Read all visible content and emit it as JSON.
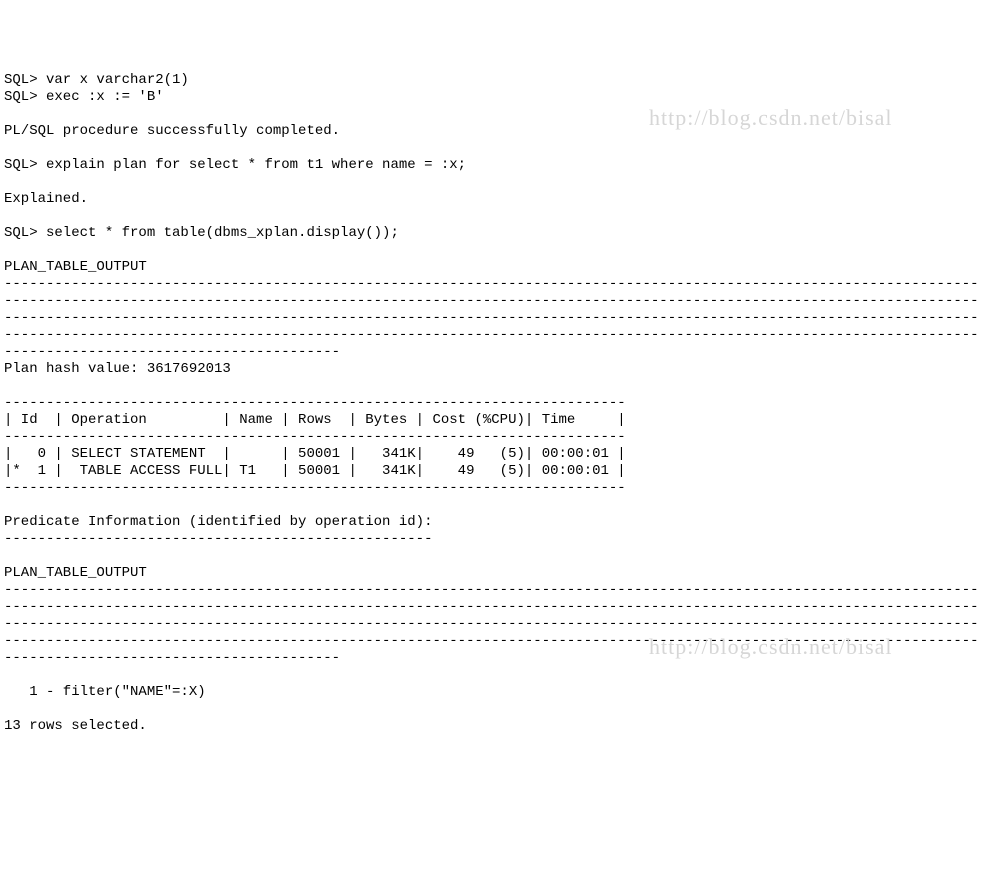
{
  "watermark": "http://blog.csdn.net/bisal",
  "sql": {
    "line01": "SQL> var x varchar2(1)",
    "line02": "SQL> exec :x := 'B'",
    "line03": "",
    "line04": "PL/SQL procedure successfully completed.",
    "line05": "",
    "line06": "SQL> explain plan for select * from t1 where name = :x;",
    "line07": "",
    "line08": "Explained.",
    "line09": "",
    "line10": "SQL> select * from table(dbms_xplan.display());",
    "line11": "",
    "line12": "PLAN_TABLE_OUTPUT",
    "line13": "--------------------------------------------------------------------------------------------------------------------",
    "line14": "--------------------------------------------------------------------------------------------------------------------",
    "line15": "--------------------------------------------------------------------------------------------------------------------",
    "line16": "--------------------------------------------------------------------------------------------------------------------",
    "line17": "----------------------------------------",
    "line18": "Plan hash value: 3617692013",
    "line19": "",
    "line20": "--------------------------------------------------------------------------",
    "line21": "| Id  | Operation         | Name | Rows  | Bytes | Cost (%CPU)| Time     |",
    "line22": "--------------------------------------------------------------------------",
    "line23": "|   0 | SELECT STATEMENT  |      | 50001 |   341K|    49   (5)| 00:00:01 |",
    "line24": "|*  1 |  TABLE ACCESS FULL| T1   | 50001 |   341K|    49   (5)| 00:00:01 |",
    "line25": "--------------------------------------------------------------------------",
    "line26": "",
    "line27": "Predicate Information (identified by operation id):",
    "line28": "---------------------------------------------------",
    "line29": "",
    "line30": "PLAN_TABLE_OUTPUT",
    "line31": "--------------------------------------------------------------------------------------------------------------------",
    "line32": "--------------------------------------------------------------------------------------------------------------------",
    "line33": "--------------------------------------------------------------------------------------------------------------------",
    "line34": "--------------------------------------------------------------------------------------------------------------------",
    "line35": "----------------------------------------",
    "line36": "",
    "line37": "   1 - filter(\"NAME\"=:X)",
    "line38": "",
    "line39": "13 rows selected."
  }
}
